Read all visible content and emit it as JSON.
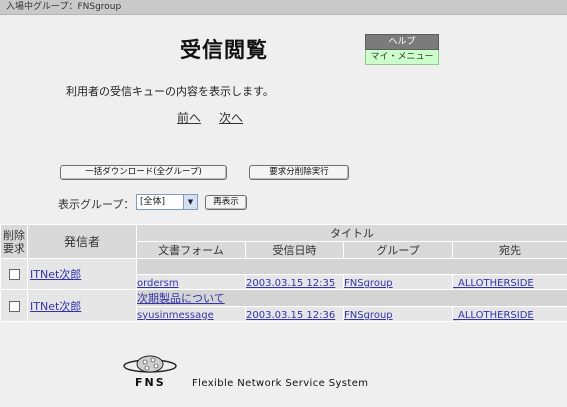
{
  "topbar": {
    "group_status": "入場中グループ：FNSgroup"
  },
  "header": {
    "title": "受信閲覧",
    "help": "ヘルプ",
    "my_menu": "マイ・メニュー"
  },
  "description": "利用者の受信キューの内容を表示します。",
  "pager": {
    "prev": "前へ",
    "next": "次へ"
  },
  "actions": {
    "bulk_download": "一括ダウンロード(全グループ)",
    "execute_delete": "要求分削除実行"
  },
  "filter": {
    "label": "表示グループ：",
    "selected": "[全体]",
    "redisplay": "再表示"
  },
  "table": {
    "headers": {
      "delete": "削除要求",
      "sender": "発信者",
      "title": "タイトル",
      "form": "文書フォーム",
      "received": "受信日時",
      "group": "グループ",
      "recipient": "宛先"
    },
    "rows": [
      {
        "sender": "ITNet次郎",
        "title": "",
        "form": "ordersm",
        "received": "2003.03.15 12:35",
        "group": "FNSgroup",
        "recipient": "_ALLOTHERSIDE"
      },
      {
        "sender": "ITNet次郎",
        "title": "次期製品について",
        "form": "syusinmessage",
        "received": "2003.03.15 12:36",
        "group": "FNSgroup",
        "recipient": "_ALLOTHERSIDE"
      }
    ]
  },
  "footer": {
    "logo_text": "FNS",
    "system_name": "Flexible Network Service System"
  }
}
